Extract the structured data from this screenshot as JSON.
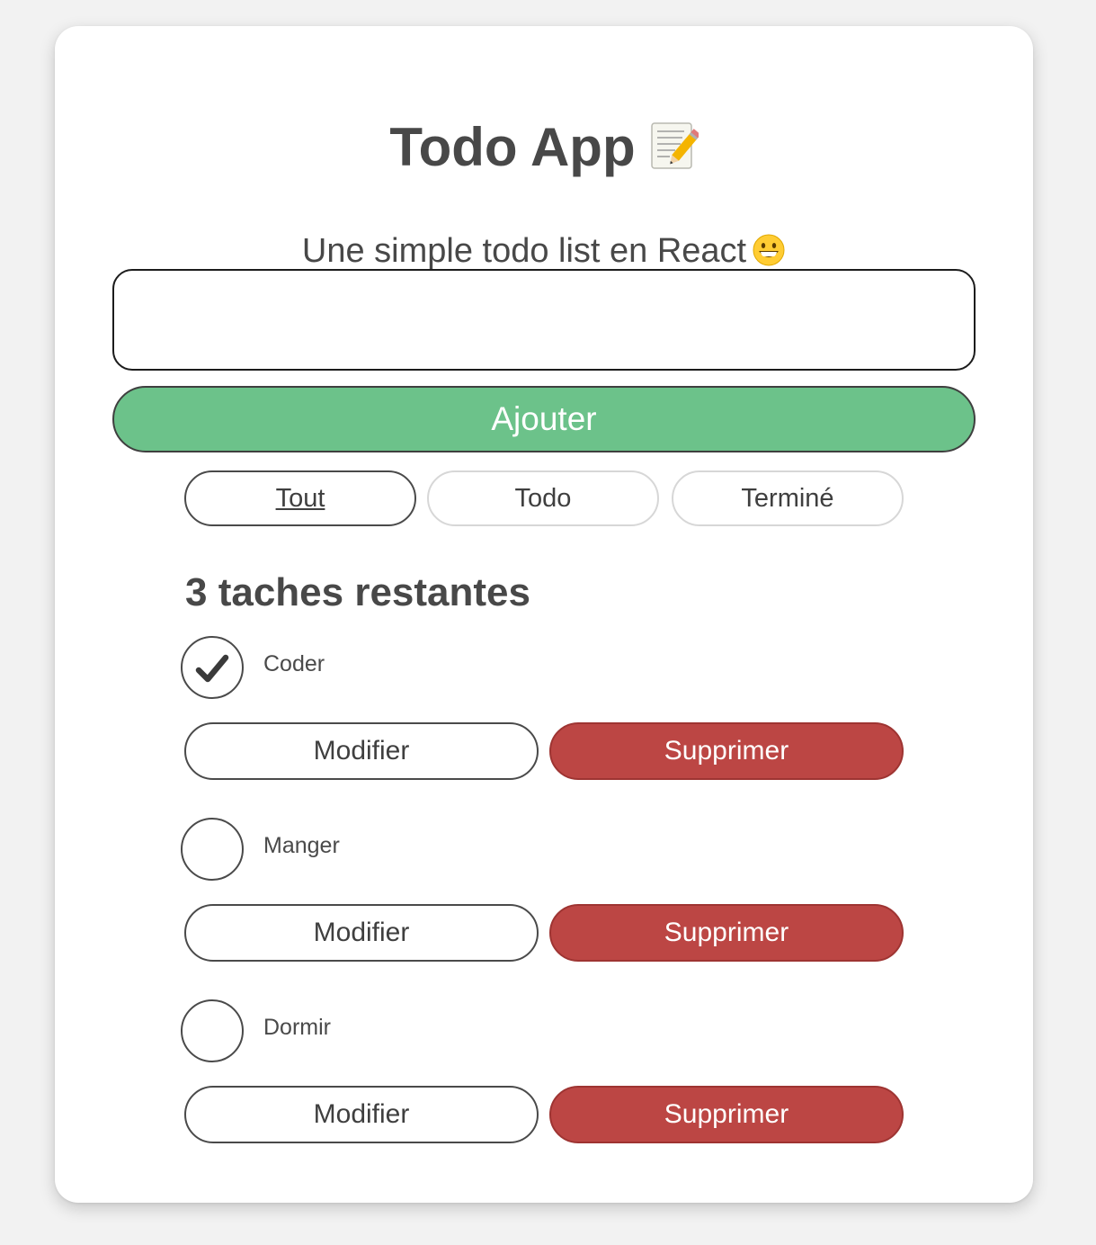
{
  "app": {
    "title": "Todo App",
    "subtitle": "Une simple todo list en React",
    "title_icon": "memo-pencil-icon",
    "subtitle_icon": "grinning-face-icon"
  },
  "form": {
    "input_value": "",
    "add_label": "Ajouter"
  },
  "filters": [
    {
      "label": "Tout",
      "active": true
    },
    {
      "label": "Todo",
      "active": false
    },
    {
      "label": "Terminé",
      "active": false
    }
  ],
  "remaining_text": "3 taches restantes",
  "todos": [
    {
      "label": "Coder",
      "completed": true,
      "edit_label": "Modifier",
      "delete_label": "Supprimer"
    },
    {
      "label": "Manger",
      "completed": false,
      "edit_label": "Modifier",
      "delete_label": "Supprimer"
    },
    {
      "label": "Dormir",
      "completed": false,
      "edit_label": "Modifier",
      "delete_label": "Supprimer"
    }
  ],
  "colors": {
    "add_button": "#6cc28a",
    "delete_button": "#bc4644",
    "text": "#484848"
  }
}
